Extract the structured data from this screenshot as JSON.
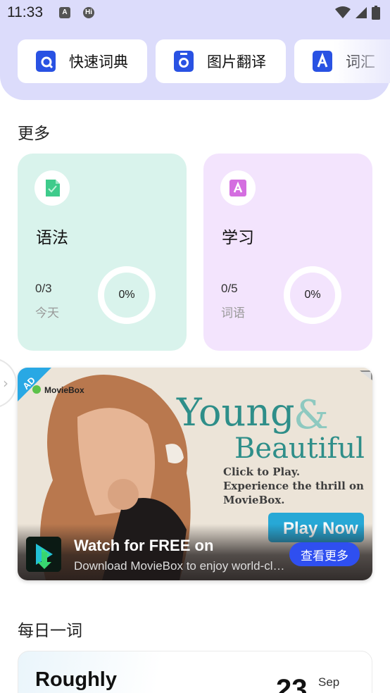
{
  "status_bar": {
    "time": "11:33",
    "icons": [
      "a-app-icon",
      "hi-app-icon",
      "wifi-icon",
      "signal-icon",
      "battery-icon"
    ]
  },
  "quick_tools": [
    {
      "label": "快速词典",
      "icon": "search-icon"
    },
    {
      "label": "图片翻译",
      "icon": "camera-icon"
    },
    {
      "label": "词汇",
      "icon": "vocabulary-icon"
    }
  ],
  "more": {
    "title": "更多",
    "cards": [
      {
        "title": "语法",
        "count": "0/3",
        "subtitle": "今天",
        "percent": "0%",
        "progress": 0,
        "accent": "#3ecb8b"
      },
      {
        "title": "学习",
        "count": "0/5",
        "subtitle": "词语",
        "percent": "0%",
        "progress": 0,
        "accent": "#d46ee0"
      }
    ]
  },
  "ad": {
    "badge": "AD",
    "brand": "MovieBox",
    "headline_1": "Young",
    "headline_amp": "&",
    "headline_2": "Beautiful",
    "tagline_1": "Click to Play.",
    "tagline_2": "Experience the thrill on",
    "tagline_3": "MovieBox.",
    "play_button": "Play Now",
    "title": "Watch for FREE on",
    "description": "Download MovieBox to enjoy world-class movies",
    "cta": "查看更多"
  },
  "daily_word": {
    "title": "每日一词",
    "word": "Roughly",
    "day": "23",
    "month": "Sep"
  },
  "colors": {
    "header_bg": "#dcdcfb",
    "tool_icon": "#2952e3",
    "cta": "#2f4ff0"
  }
}
